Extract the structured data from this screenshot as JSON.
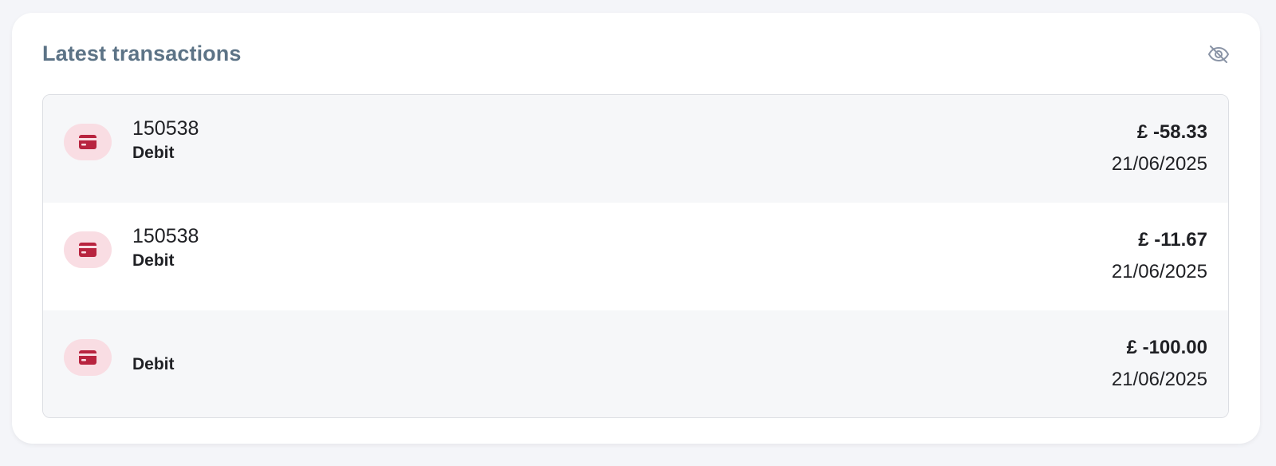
{
  "widget": {
    "title": "Latest transactions",
    "hide_icon": "eye-off-icon"
  },
  "colors": {
    "title": "#5c7386",
    "icon_bg": "#f9dde3",
    "icon_fg": "#b8243f",
    "row_alt": "#f6f7f9"
  },
  "transactions": [
    {
      "reference": "150538",
      "type": "Debit",
      "amount": "£ -58.33",
      "date": "21/06/2025",
      "icon": "credit-card-icon"
    },
    {
      "reference": "150538",
      "type": "Debit",
      "amount": "£ -11.67",
      "date": "21/06/2025",
      "icon": "credit-card-icon"
    },
    {
      "reference": "",
      "type": "Debit",
      "amount": "£ -100.00",
      "date": "21/06/2025",
      "icon": "credit-card-icon"
    }
  ]
}
